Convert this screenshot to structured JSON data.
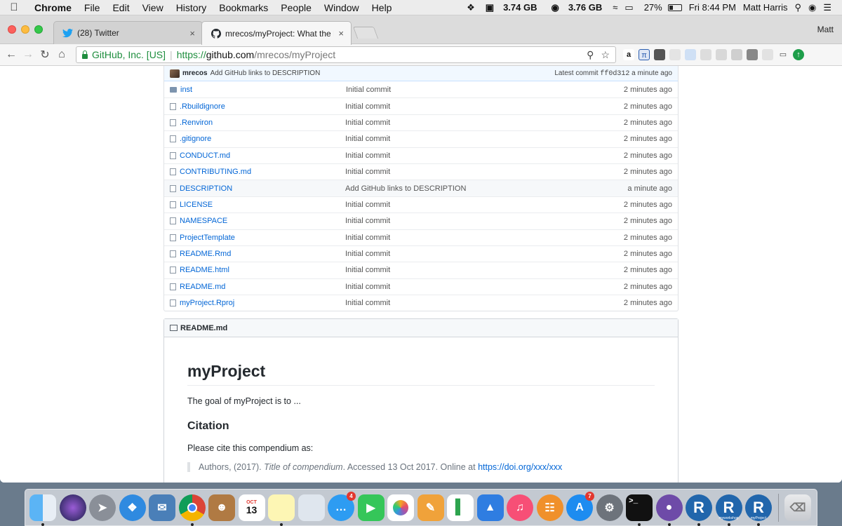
{
  "menubar": {
    "app": "Chrome",
    "menus": [
      "File",
      "Edit",
      "View",
      "History",
      "Bookmarks",
      "People",
      "Window",
      "Help"
    ],
    "status_mem1": "3.74 GB",
    "status_mem2": "3.76 GB",
    "battery": "27%",
    "clock": "Fri 8:44 PM",
    "user": "Matt Harris"
  },
  "browser": {
    "tabs": [
      {
        "title": "(28) Twitter",
        "close": "×"
      },
      {
        "title": "mrecos/myProject: What the P",
        "close": "×"
      }
    ],
    "profile": "Matt",
    "security_label": "GitHub, Inc. [US]",
    "url_scheme": "https://",
    "url_host": "github.com",
    "url_path": "/mrecos/myProject"
  },
  "repo": {
    "latest_commit": {
      "author": "mrecos",
      "message": "Add GitHub links to DESCRIPTION",
      "prefix": "Latest commit",
      "sha": "ff0d312",
      "age": "a minute ago"
    },
    "files": [
      {
        "name": "inst",
        "type": "folder",
        "message": "Initial commit",
        "age": "2 minutes ago"
      },
      {
        "name": ".Rbuildignore",
        "type": "file",
        "message": "Initial commit",
        "age": "2 minutes ago"
      },
      {
        "name": ".Renviron",
        "type": "file",
        "message": "Initial commit",
        "age": "2 minutes ago"
      },
      {
        "name": ".gitignore",
        "type": "file",
        "message": "Initial commit",
        "age": "2 minutes ago"
      },
      {
        "name": "CONDUCT.md",
        "type": "file",
        "message": "Initial commit",
        "age": "2 minutes ago"
      },
      {
        "name": "CONTRIBUTING.md",
        "type": "file",
        "message": "Initial commit",
        "age": "2 minutes ago"
      },
      {
        "name": "DESCRIPTION",
        "type": "file",
        "message": "Add GitHub links to DESCRIPTION",
        "age": "a minute ago"
      },
      {
        "name": "LICENSE",
        "type": "file",
        "message": "Initial commit",
        "age": "2 minutes ago"
      },
      {
        "name": "NAMESPACE",
        "type": "file",
        "message": "Initial commit",
        "age": "2 minutes ago"
      },
      {
        "name": "ProjectTemplate",
        "type": "file",
        "message": "Initial commit",
        "age": "2 minutes ago"
      },
      {
        "name": "README.Rmd",
        "type": "file",
        "message": "Initial commit",
        "age": "2 minutes ago"
      },
      {
        "name": "README.html",
        "type": "file",
        "message": "Initial commit",
        "age": "2 minutes ago"
      },
      {
        "name": "README.md",
        "type": "file",
        "message": "Initial commit",
        "age": "2 minutes ago"
      },
      {
        "name": "myProject.Rproj",
        "type": "file",
        "message": "Initial commit",
        "age": "2 minutes ago"
      }
    ]
  },
  "readme": {
    "header": "README.md",
    "title": "myProject",
    "intro": "The goal of myProject is to ...",
    "citation_heading": "Citation",
    "citation_text": "Please cite this compendium as:",
    "quote_prefix": "Authors, (2017).",
    "quote_title": "Title of compendium",
    "quote_mid": ". Accessed 13 Oct 2017. Online at",
    "quote_link": "https://doi.org/xxx/xxx"
  },
  "dock": {
    "calendar_month": "OCT",
    "calendar_day": "13",
    "messages_badge": "4",
    "facetime_badge": "",
    "appstore_badge": "7",
    "r_labels": [
      "",
      "myworkshop",
      "myProject"
    ]
  }
}
